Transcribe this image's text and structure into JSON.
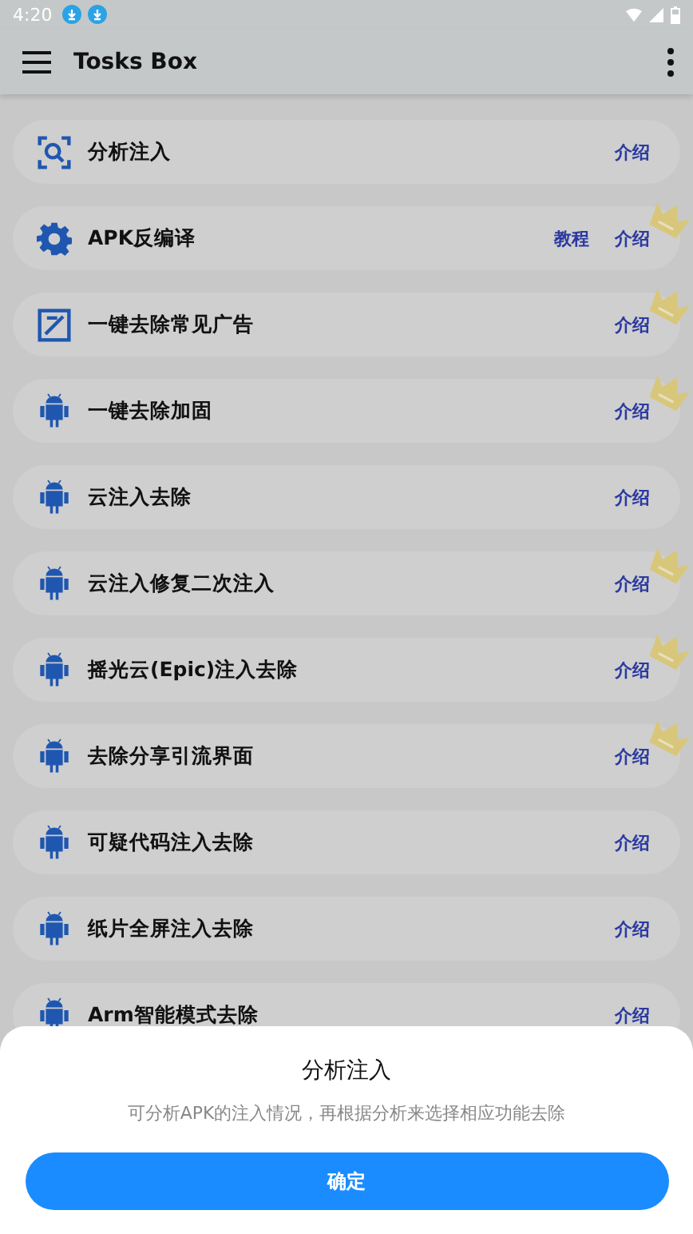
{
  "status_bar": {
    "time": "4:20"
  },
  "app_bar": {
    "title": "Tosks Box"
  },
  "tools": [
    {
      "kind": "scan",
      "name": "分析注入",
      "intro": "介绍",
      "crown": false
    },
    {
      "kind": "gear",
      "name": "APK反编译",
      "tutorial": "教程",
      "intro": "介绍",
      "crown": true
    },
    {
      "kind": "edit",
      "name": "一键去除常见广告",
      "intro": "介绍",
      "crown": true
    },
    {
      "kind": "android",
      "name": "一键去除加固",
      "intro": "介绍",
      "crown": true
    },
    {
      "kind": "android",
      "name": "云注入去除",
      "intro": "介绍",
      "crown": false
    },
    {
      "kind": "android",
      "name": "云注入修复二次注入",
      "intro": "介绍",
      "crown": true
    },
    {
      "kind": "android",
      "name": "摇光云(Epic)注入去除",
      "intro": "介绍",
      "crown": true
    },
    {
      "kind": "android",
      "name": "去除分享引流界面",
      "intro": "介绍",
      "crown": true
    },
    {
      "kind": "android",
      "name": "可疑代码注入去除",
      "intro": "介绍",
      "crown": false
    },
    {
      "kind": "android",
      "name": "纸片全屏注入去除",
      "intro": "介绍",
      "crown": false
    },
    {
      "kind": "android",
      "name": "Arm智能模式去除",
      "intro": "介绍",
      "crown": false
    }
  ],
  "sheet": {
    "title": "分析注入",
    "message": "可分析APK的注入情况，再根据分析来选择相应功能去除",
    "button": "确定"
  }
}
